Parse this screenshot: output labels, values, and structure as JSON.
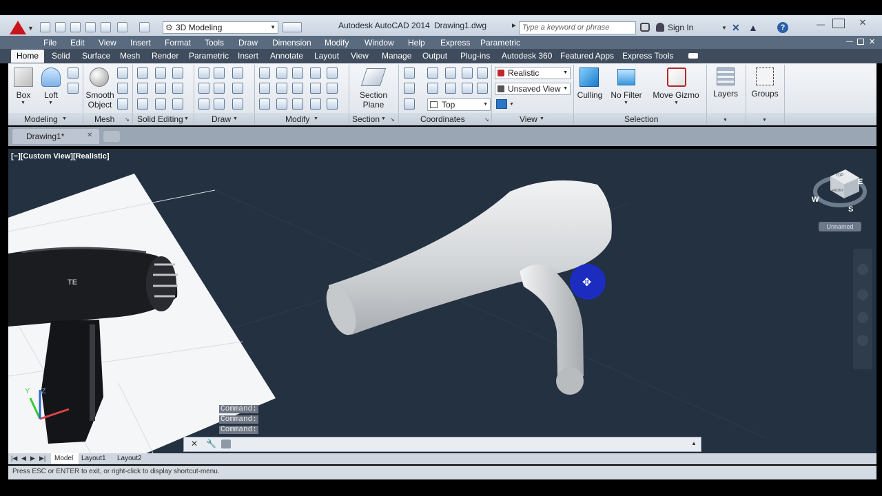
{
  "window": {
    "app_title": "Autodesk AutoCAD 2014",
    "file_name": "Drawing1.dwg",
    "workspace": "3D Modeling",
    "search_placeholder": "Type a keyword or phrase",
    "sign_in": "Sign In"
  },
  "menu": [
    "File",
    "Edit",
    "View",
    "Insert",
    "Format",
    "Tools",
    "Draw",
    "Dimension",
    "Modify",
    "Window",
    "Help",
    "Express",
    "Parametric"
  ],
  "ribbon_tabs": [
    "Home",
    "Solid",
    "Surface",
    "Mesh",
    "Render",
    "Parametric",
    "Insert",
    "Annotate",
    "Layout",
    "View",
    "Manage",
    "Output",
    "Plug-ins",
    "Autodesk 360",
    "Featured Apps",
    "Express Tools"
  ],
  "ribbon": {
    "box": "Box",
    "loft": "Loft",
    "smooth_object_1": "Smooth",
    "smooth_object_2": "Object",
    "section_plane_1": "Section",
    "section_plane_2": "Plane",
    "visual_style": "Realistic",
    "view_saved": "Unsaved View",
    "view_dir": "Top",
    "culling": "Culling",
    "no_filter": "No Filter",
    "move_gizmo": "Move Gizmo",
    "layers": "Layers",
    "groups": "Groups",
    "panels": [
      "Modeling",
      "Mesh",
      "Solid Editing",
      "Draw",
      "Modify",
      "Section",
      "Coordinates",
      "View",
      "Selection"
    ]
  },
  "doc_tab": "Drawing1*",
  "viewport_label": "[−][Custom View][Realistic]",
  "viewcube": {
    "top": "TOP",
    "front": "FRONT",
    "w": "W",
    "e": "E",
    "s": "S",
    "ucs": "Unnamed"
  },
  "ucs_icon": {
    "z": "Z",
    "y": "Y"
  },
  "command_history": [
    "Command:",
    "Command:",
    "Command:"
  ],
  "layout_tabs": [
    "Model",
    "Layout1",
    "Layout2"
  ],
  "status_text": "Press ESC or ENTER to exit, or right-click to display shortcut-menu.",
  "colors": {
    "viewport_bg": "#233140",
    "model_surface": "#d6d9dc",
    "cursor_blue": "#1a2bd6"
  }
}
